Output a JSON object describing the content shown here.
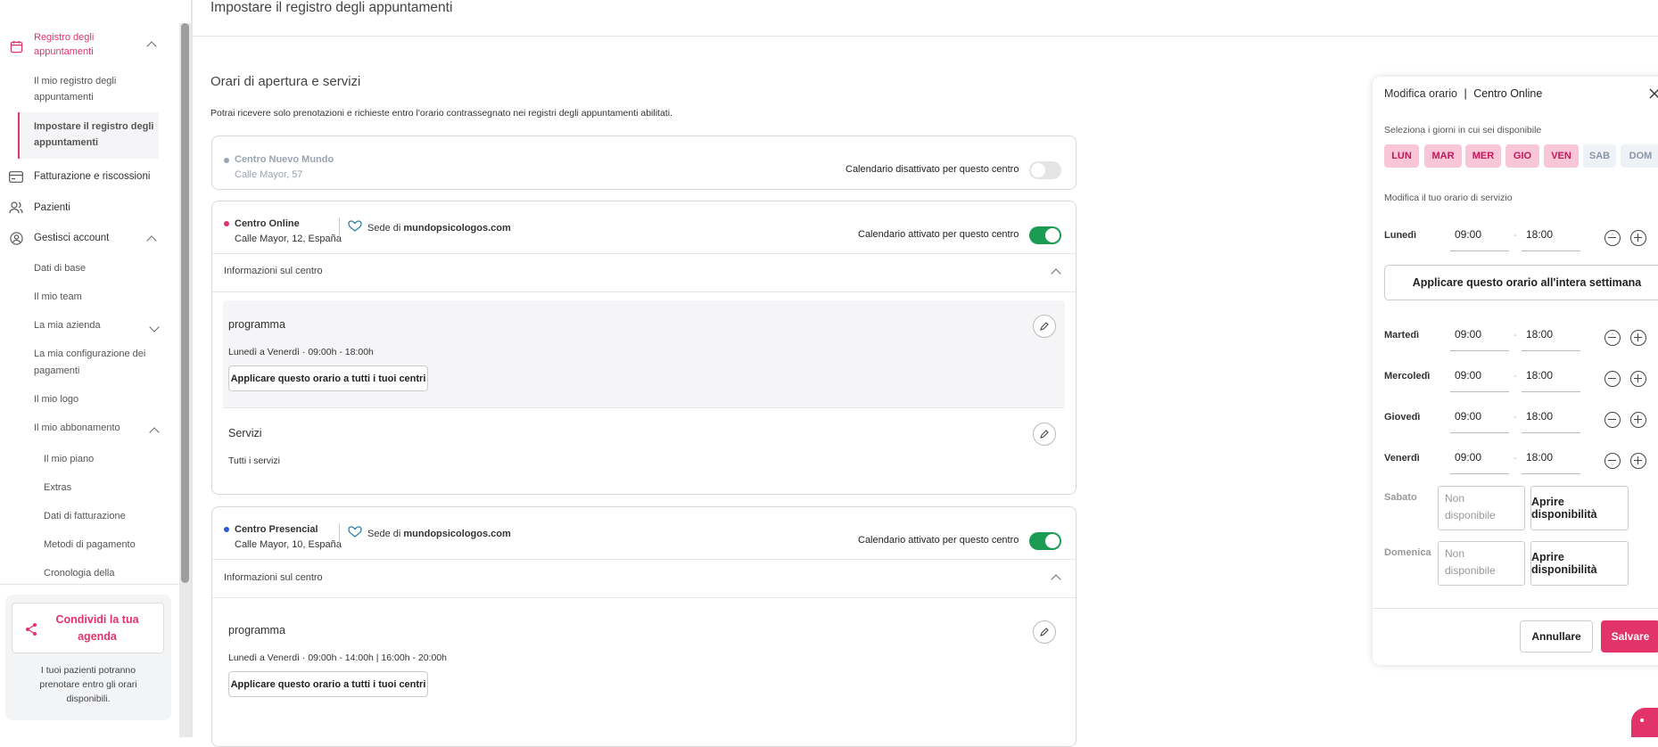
{
  "sidebar": {
    "registro": "Registro degli appuntamenti",
    "registro_l1": "Registro degli",
    "registro_l2": "appuntamenti",
    "mio_registro_l1": "Il mio registro degli",
    "mio_registro_l2": "appuntamenti",
    "impostare_l1": "Impostare il registro degli",
    "impostare_l2": "appuntamenti",
    "fatturazione": "Fatturazione e riscossioni",
    "pazienti": "Pazienti",
    "gestisci": "Gestisci account",
    "dati_base": "Dati di base",
    "team": "Il mio team",
    "azienda": "La mia azienda",
    "config_l1": "La mia configurazione dei",
    "config_l2": "pagamenti",
    "logo": "Il mio logo",
    "abbonamento": "Il mio abbonamento",
    "piano": "Il mio piano",
    "extras": "Extras",
    "dati_fatt": "Dati di fatturazione",
    "metodi": "Metodi di pagamento",
    "cronologia": "Cronologia della",
    "share_l1": "Condividi la tua",
    "share_l2": "agenda",
    "share_desc_l1": "I tuoi pazienti potranno",
    "share_desc_l2": "prenotare entro gli orari",
    "share_desc_l3": "disponibili."
  },
  "main": {
    "page_title": "Impostare il registro degli appuntamenti",
    "section_title": "Orari di apertura e servizi",
    "section_desc": "Potrai ricevere solo prenotazioni e richieste entro l'orario contrassegnato nei registri degli appuntamenti abilitati.",
    "centers": [
      {
        "name": "Centro Nuevo Mundo",
        "address": "Calle Mayor, 57",
        "status": "Calendario disattivato per questo centro",
        "dot": "#9aa3b0"
      },
      {
        "name": "Centro Online",
        "address": "Calle Mayor, 12, España",
        "sede": "Sede di ",
        "sede_site": "mundopsicologos.com",
        "status": "Calendario attivato per questo centro",
        "info": "Informazioni sul centro",
        "programma": "programma",
        "hours_days": "Lunedì a Venerdì · ",
        "hours": "09:00h - 18:00h",
        "apply": "Applicare questo orario a tutti i tuoi centri",
        "servizi": "Servizi",
        "servizi_val": "Tutti i servizi",
        "dot": "#e3336b"
      },
      {
        "name": "Centro Presencial",
        "address": "Calle Mayor, 10, España",
        "sede": "Sede di ",
        "sede_site": "mundopsicologos.com",
        "status": "Calendario attivato per questo centro",
        "info": "Informazioni sul centro",
        "programma": "programma",
        "hours_days": "Lunedì a Venerdì · ",
        "hours": "09:00h - 14:00h |  16:00h - 20:00h",
        "apply": "Applicare questo orario a tutti i tuoi centri",
        "dot": "#2b5cd6"
      }
    ]
  },
  "panel": {
    "title": "Modifica orario",
    "sep": "|",
    "center": "Centro Online",
    "days_label": "Seleziona i giorni in cui sei disponibile",
    "days": [
      "LUN",
      "MAR",
      "MER",
      "GIO",
      "VEN",
      "SAB",
      "DOM"
    ],
    "hours_label": "Modifica il tuo orario di servizio",
    "apply_week": "Applicare questo orario all'intera settimana",
    "rows": [
      {
        "day": "Lunedì",
        "from": "09:00",
        "to": "18:00"
      },
      {
        "day": "Martedì",
        "from": "09:00",
        "to": "18:00"
      },
      {
        "day": "Mercoledì",
        "from": "09:00",
        "to": "18:00"
      },
      {
        "day": "Giovedì",
        "from": "09:00",
        "to": "18:00"
      },
      {
        "day": "Venerdì",
        "from": "09:00",
        "to": "18:00"
      }
    ],
    "dash": "-",
    "sabato": "Sabato",
    "domenica": "Domenica",
    "non_disp_l1": "Non",
    "non_disp_l2": "disponibile",
    "open": "Aprire disponibilità",
    "cancel": "Annullare",
    "save": "Salvare"
  },
  "colors": {
    "accent": "#e3336b",
    "toggle_on": "#1c9b52"
  }
}
